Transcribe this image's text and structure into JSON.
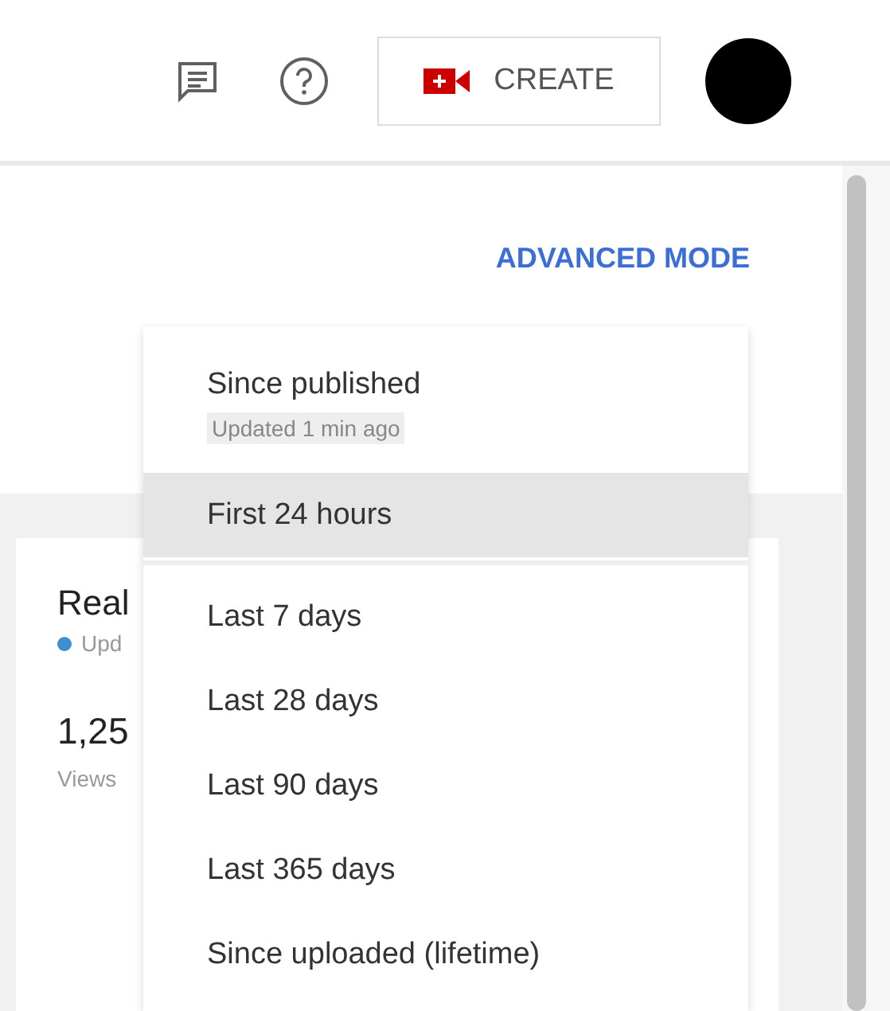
{
  "header": {
    "create_button": "CREATE"
  },
  "advanced_mode_link": "ADVANCED MODE",
  "card": {
    "title": "Real",
    "status": "Upd",
    "value": "1,25",
    "caption": "Views"
  },
  "period_menu": {
    "items": [
      {
        "label": "Since published",
        "note": "Updated 1 min ago",
        "selected": false,
        "divider_after": false
      },
      {
        "label": "First 24 hours",
        "selected": true,
        "divider_after": true
      },
      {
        "label": "Last 7 days",
        "selected": false,
        "divider_after": false
      },
      {
        "label": "Last 28 days",
        "selected": false,
        "divider_after": false
      },
      {
        "label": "Last 90 days",
        "selected": false,
        "divider_after": false
      },
      {
        "label": "Last 365 days",
        "selected": false,
        "divider_after": false
      },
      {
        "label": "Since uploaded (lifetime)",
        "selected": false,
        "divider_after": false
      }
    ]
  }
}
